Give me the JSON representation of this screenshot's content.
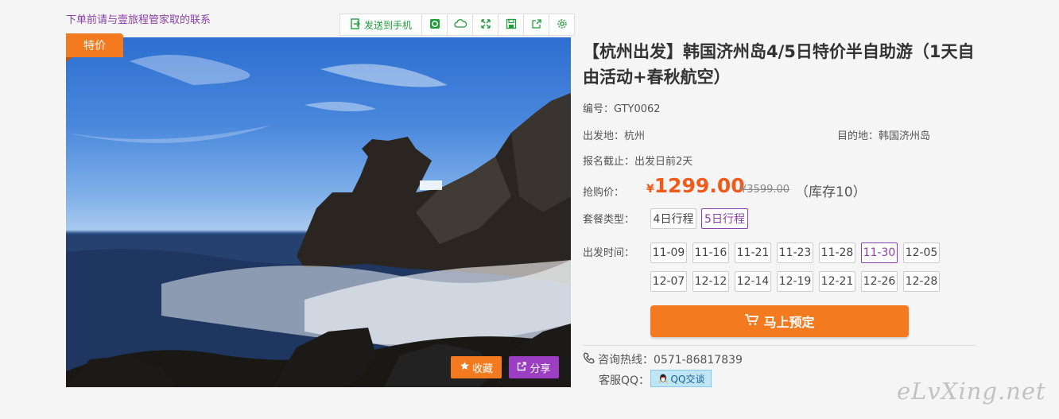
{
  "notice": "下单前请与壹旅程管家取的联系",
  "toolbar": {
    "send_label": "发送到手机",
    "icons": [
      "send-to-phone-icon",
      "wechat-icon",
      "cloud-icon",
      "fullscreen-icon",
      "save-icon",
      "share-out-icon",
      "settings-icon"
    ]
  },
  "badge": "特价",
  "hero": {
    "favorite_label": "收藏",
    "share_label": "分享"
  },
  "product": {
    "title": "【杭州出发】韩国济州岛4/5日特价半自助游（1天自由活动+春秋航空）",
    "code": "编号：GTY0062",
    "departure": "出发地：杭州",
    "destination": "目的地：韩国济州岛",
    "deadline": "报名截止：出发日前2天",
    "price_label": "抢购价：",
    "currency": "¥",
    "price": "1299.00",
    "old_price": "¥3599.00",
    "stock": "（库存10）",
    "package_label": "套餐类型：",
    "packages": [
      {
        "label": "4日行程",
        "active": false
      },
      {
        "label": "5日行程",
        "active": true
      }
    ],
    "date_label": "出发时间：",
    "dates": [
      "11-09",
      "11-16",
      "11-21",
      "11-23",
      "11-28",
      "11-30",
      "12-05",
      "12-07",
      "12-12",
      "12-14",
      "12-19",
      "12-21",
      "12-26",
      "12-28"
    ],
    "active_date": "11-30",
    "book_label": "马上预定",
    "hotline": "咨询热线：0571-86817839",
    "qq_label": "客服QQ：",
    "qq_button": "QQ交谈"
  },
  "watermark": "eLvXing.net",
  "colors": {
    "accent": "#f47a20",
    "purple": "#8b3fa8",
    "price": "#f05a1a",
    "toolbar_icon": "#1f9e3a"
  }
}
